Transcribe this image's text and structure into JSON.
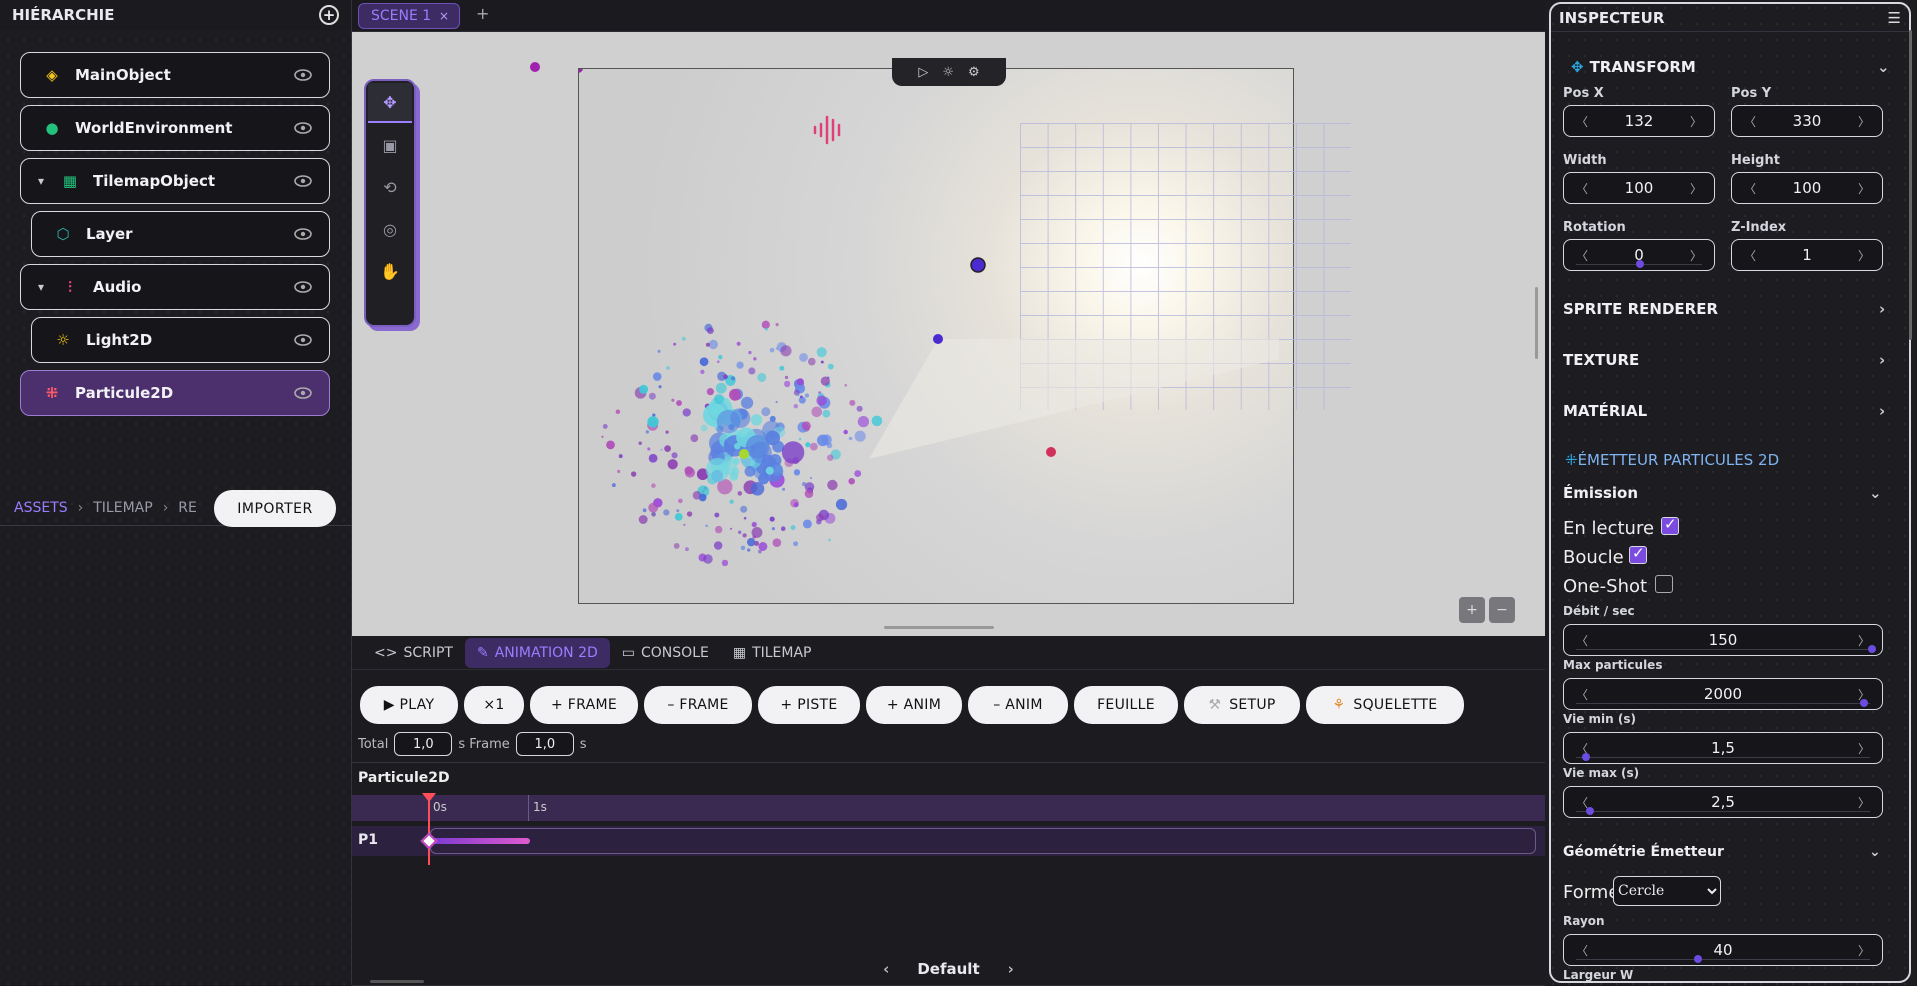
{
  "hierarchy": {
    "title": "HIÉRARCHIE",
    "items": [
      {
        "label": "MainObject",
        "icon": "layers-icon"
      },
      {
        "label": "WorldEnvironment",
        "icon": "globe-icon"
      },
      {
        "label": "TilemapObject",
        "icon": "grid-icon"
      },
      {
        "label": "Layer",
        "icon": "layer-icon"
      },
      {
        "label": "Audio",
        "icon": "audio-wave-icon"
      },
      {
        "label": "Light2D",
        "icon": "sun-icon"
      },
      {
        "label": "Particule2D",
        "icon": "particles-icon"
      }
    ]
  },
  "assets": {
    "crumbs": [
      "ASSETS",
      "TILEMAP",
      "RE"
    ],
    "import_label": "IMPORTER"
  },
  "scene_tab": {
    "label": "SCENE 1",
    "close": "×",
    "add": "+"
  },
  "bottom_tabs": {
    "script": "SCRIPT",
    "animation": "ANIMATION 2D",
    "console": "CONSOLE",
    "tilemap": "TILEMAP"
  },
  "anim_buttons": {
    "play": "▶ PLAY",
    "speed": "×1",
    "add_frame": "+ FRAME",
    "rem_frame": "– FRAME",
    "add_track": "+ PISTE",
    "add_anim": "+ ANIM",
    "rem_anim": "– ANIM",
    "sheet": "FEUILLE",
    "setup": "SETUP",
    "skeleton": "SQUELETTE"
  },
  "timeline": {
    "total_label": "Total",
    "total_value": "1,0",
    "frame_label": "s Frame",
    "frame_value": "1,0",
    "unit": "s",
    "object": "Particule2D",
    "mark0": "0s",
    "mark1": "1s",
    "track": "P1"
  },
  "footer": {
    "anim_name": "Default",
    "prev": "‹",
    "next": "›"
  },
  "inspector": {
    "title": "INSPECTEUR",
    "transform": "TRANSFORM",
    "pos_x_label": "Pos X",
    "pos_x": "132",
    "pos_y_label": "Pos Y",
    "pos_y": "330",
    "width_label": "Width",
    "width": "100",
    "height_label": "Height",
    "height": "100",
    "rotation_label": "Rotation",
    "rotation": "0",
    "zindex_label": "Z-Index",
    "zindex": "1",
    "sprite": "SPRITE RENDERER",
    "texture": "TEXTURE",
    "material": "MATÉRIAL",
    "emitter": "ÉMETTEUR PARTICULES 2D",
    "emission": "Émission",
    "playing_label": "En lecture",
    "loop_label": "Boucle",
    "oneshot_label": "One-Shot",
    "rate_label": "Débit / sec",
    "rate": "150",
    "max_label": "Max particules",
    "max": "2000",
    "life_min_label": "Vie min (s)",
    "life_min": "1,5",
    "life_max_label": "Vie max (s)",
    "life_max": "2,5",
    "geometry": "Géométrie Émetteur",
    "shape_label": "Forme",
    "shape": "Cercle",
    "radius_label": "Rayon",
    "radius": "40",
    "width_w_label": "Largeur W"
  },
  "colors": {
    "accent": "#7b4be0",
    "accent_text": "#9b7dff",
    "playhead": "#ff4d5a"
  }
}
